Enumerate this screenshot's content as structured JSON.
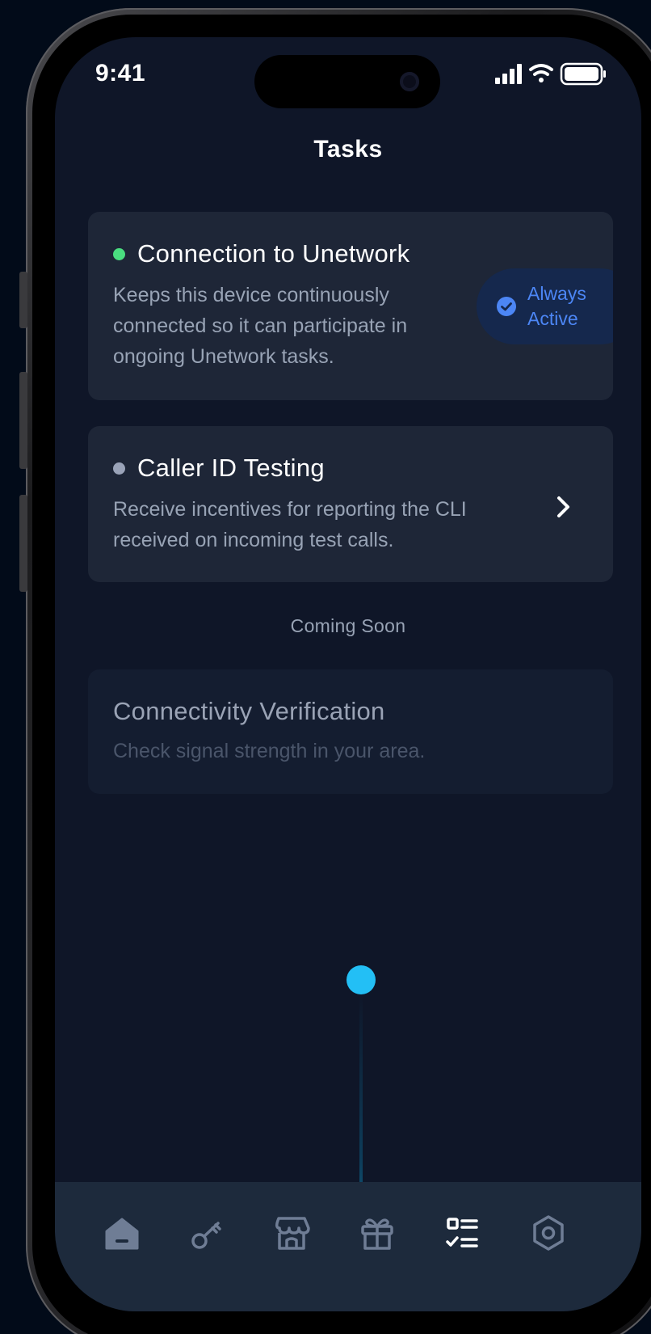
{
  "status_bar": {
    "time": "9:41"
  },
  "header": {
    "title": "Tasks"
  },
  "tasks": [
    {
      "title": "Connection to Unetwork",
      "description_lines": [
        "Keeps this device continuously",
        "connected so it can participate in",
        "ongoing Unetwork tasks."
      ],
      "status_dot_color": "#4ade80",
      "badge_lines": [
        "Always",
        "Active"
      ]
    },
    {
      "title": "Caller ID Testing",
      "description_lines": [
        "Receive incentives for reporting the CLI",
        "received on incoming test calls."
      ],
      "status_dot_color": "#9aa3b8"
    }
  ],
  "coming_soon": {
    "label": "Coming Soon",
    "items": [
      {
        "title": "Connectivity Verification",
        "description": "Check signal strength in your area."
      }
    ]
  },
  "tabbar": {
    "items": [
      {
        "icon": "home-icon",
        "active": false
      },
      {
        "icon": "key-icon",
        "active": false
      },
      {
        "icon": "store-icon",
        "active": false
      },
      {
        "icon": "gift-icon",
        "active": false
      },
      {
        "icon": "tasks-icon",
        "active": true
      },
      {
        "icon": "settings-hexagon-icon",
        "active": false
      }
    ]
  },
  "colors": {
    "background": "#0f1628",
    "card": "#1e2637",
    "accent_blue": "#4c86f5",
    "active_dot_green": "#4ade80",
    "cursor": "#23bff5"
  }
}
